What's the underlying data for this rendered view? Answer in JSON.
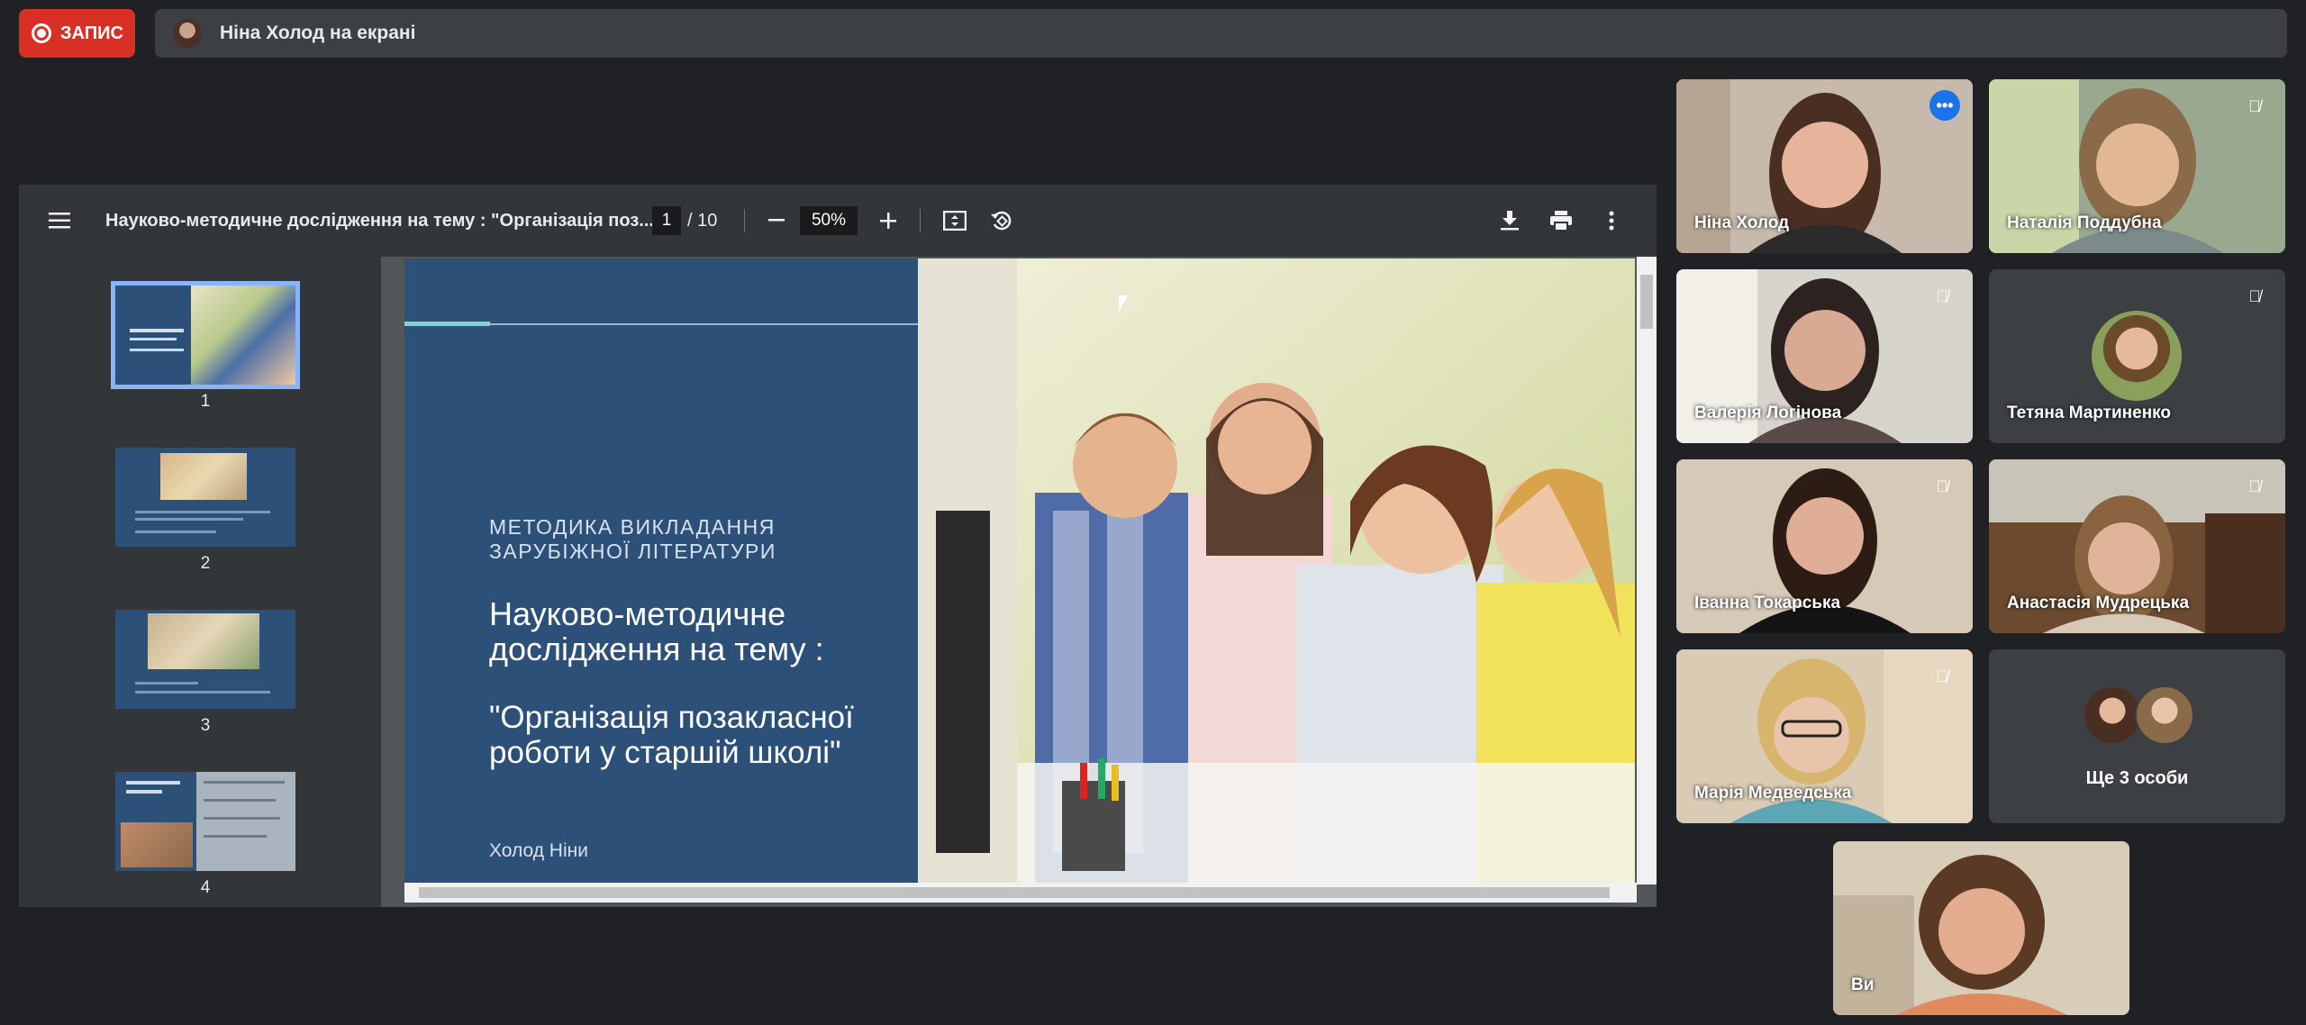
{
  "record": {
    "label": "ЗАПИС"
  },
  "presenter": {
    "text": "Ніна Холод на екрані"
  },
  "pdf": {
    "title": "Науково-методичне дослідження на тему : \"Організація поз...",
    "page": "1",
    "total": "/ 10",
    "zoom": "50%",
    "thumbnails": [
      {
        "num": "1"
      },
      {
        "num": "2"
      },
      {
        "num": "3"
      },
      {
        "num": "4"
      }
    ],
    "slide": {
      "subtitle": "МЕТОДИКА ВИКЛАДАННЯ ЗАРУБІЖНОЇ ЛІТЕРАТУРИ",
      "title": "Науково-методичне дослідження на тему :",
      "quote": "\"Організація позакласної роботи у старшій школі\"",
      "author": "Холод Ніни"
    }
  },
  "participants": [
    {
      "name": "Ніна Холод"
    },
    {
      "name": "Наталія Поддубна"
    },
    {
      "name": "Валерія Логінова"
    },
    {
      "name": "Тетяна Мартиненко"
    },
    {
      "name": "Іванна Токарська"
    },
    {
      "name": "Анастасія Мудрецька"
    },
    {
      "name": "Марія Медведська"
    },
    {
      "name": "Ще 3 особи"
    },
    {
      "name": "Ви"
    }
  ],
  "colors": {
    "record": "#d93025",
    "accent": "#8ab4f8",
    "slide_bg": "#2d5079"
  }
}
